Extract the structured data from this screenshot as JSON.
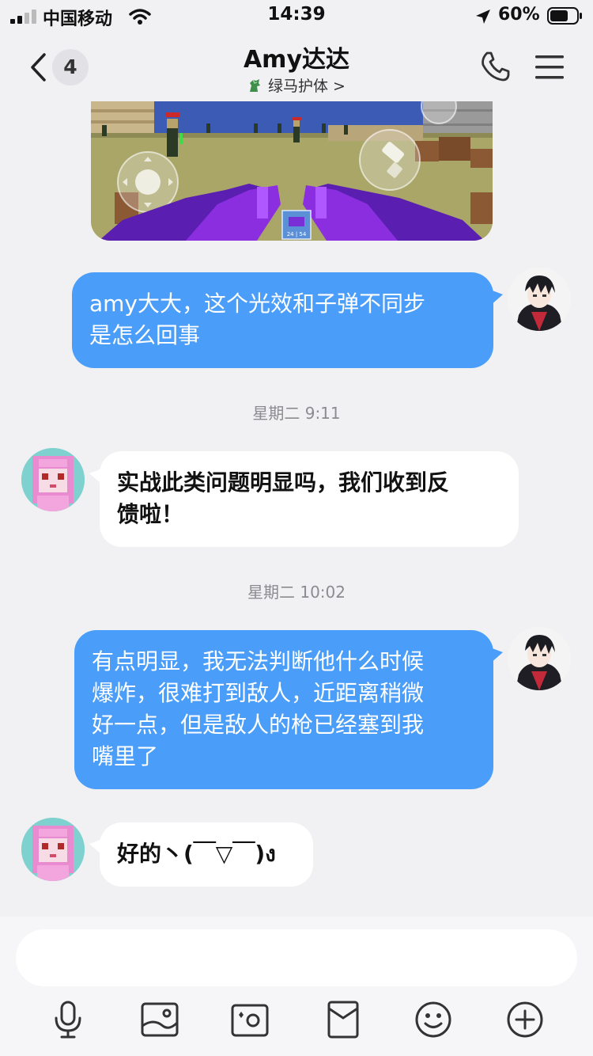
{
  "status_bar": {
    "carrier": "中国移动",
    "time": "14:39",
    "battery": "60%"
  },
  "header": {
    "back_count": "4",
    "contact_name": "Amy达达",
    "subtitle": "绿马护体 >"
  },
  "game_screenshot": {
    "ammo": "24 | 54"
  },
  "messages": [
    {
      "sender": "self",
      "text_lines": [
        "amy大大，这个光效和子弹不同步",
        "是怎么回事"
      ]
    },
    {
      "timestamp": "星期二 9:11"
    },
    {
      "sender": "Amy达达",
      "text_lines": [
        "实战此类问题明显吗，我们收到反",
        "馈啦！"
      ]
    },
    {
      "timestamp": "星期二 10:02"
    },
    {
      "sender": "self",
      "text_lines": [
        "有点明显，我无法判断他什么时候",
        "爆炸，很难打到敌人，近距离稍微",
        "好一点，但是敌人的枪已经塞到我",
        "嘴里了"
      ]
    },
    {
      "sender": "Amy达达",
      "text_lines": [
        "好的丶(￣▽￣)ง"
      ]
    }
  ],
  "input": {
    "value": "",
    "placeholder": ""
  },
  "toolbar": [
    "microphone-icon",
    "image-icon",
    "camera-icon",
    "red-packet-icon",
    "emoji-icon",
    "plus-icon"
  ],
  "colors": {
    "self_bubble": "#4a9df8",
    "other_bubble": "#ffffff",
    "background": "#f1f1f3"
  }
}
